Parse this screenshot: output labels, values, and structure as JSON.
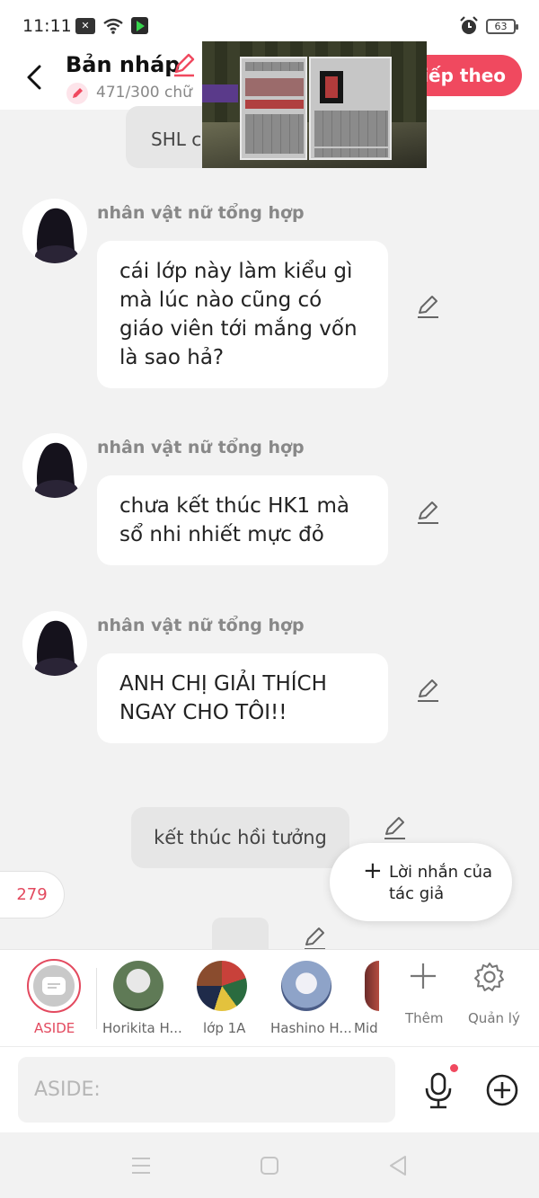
{
  "status_bar": {
    "time": "11:11",
    "notification_badge": "✕",
    "battery": "63"
  },
  "header": {
    "title": "Bản nháp",
    "word_count": "471/300 chữ",
    "next_button": "Tiếp theo"
  },
  "chat": {
    "top_system_text": "SHL c",
    "messages": [
      {
        "character": "nhân vật nữ tổng hợp",
        "text": "cái lớp này làm kiểu gì mà lúc nào cũng có giáo viên tới mắng vốn là sao hả?"
      },
      {
        "character": "nhân vật nữ tổng hợp",
        "text": "chưa kết thúc HK1 mà sổ nhi nhiết mực đỏ"
      },
      {
        "character": "nhân vật nữ tổng hợp",
        "text": "ANH CHỊ GIẢI THÍCH NGAY CHO TÔI!!"
      }
    ],
    "system_message": "kết thúc hồi tưởng",
    "counter": "279",
    "author_note": {
      "plus": "+",
      "label": "Lời nhắn của tác giả"
    }
  },
  "characters": {
    "active_label": "ASIDE",
    "items": [
      {
        "label": "Horikita H..."
      },
      {
        "label": "lớp 1A"
      },
      {
        "label": "Hashino H..."
      },
      {
        "label": "Mid"
      }
    ],
    "add_label": "Thêm",
    "manage_label": "Quản lý"
  },
  "input": {
    "placeholder": "ASIDE:"
  },
  "colors": {
    "accent": "#f0495f",
    "accent_text": "#e34a5f",
    "background": "#f2f2f2",
    "bubble": "#ffffff"
  },
  "icons": [
    "back-arrow-icon",
    "pencil-icon",
    "edit-icon",
    "plus-icon",
    "gear-icon",
    "microphone-icon",
    "add-circle-icon",
    "menu-icon",
    "home-icon",
    "back-triangle-icon"
  ]
}
